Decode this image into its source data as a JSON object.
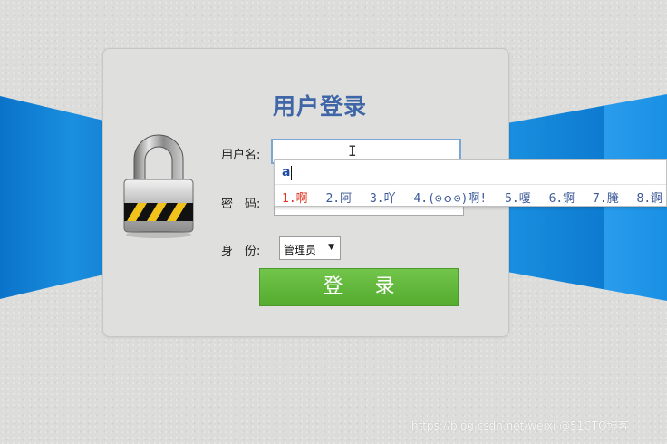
{
  "page": {
    "title": "用户登录",
    "username_label": "用户名:",
    "username_value": "",
    "password_label": "密　码:",
    "password_value": "",
    "role_label": "身　份:",
    "role_selected": "管理员",
    "login_button": "登 录"
  },
  "ime": {
    "composition": "a",
    "candidates": [
      "1.啊",
      "2.阿",
      "3.吖",
      "4.(⊙ｏ⊙)啊!",
      "5.嗄",
      "6.锕",
      "7.腌",
      "8.锕"
    ]
  },
  "watermark": "https://blog.csdn.net/weixi @51CTO博客",
  "icons": {
    "lock": "padlock-icon",
    "cursor": "text-cursor-icon",
    "dropdown": "triangle-down-icon"
  },
  "colors": {
    "title": "#3f66a7",
    "button": "#5cb536",
    "ribbon": "#1a8fe0"
  }
}
